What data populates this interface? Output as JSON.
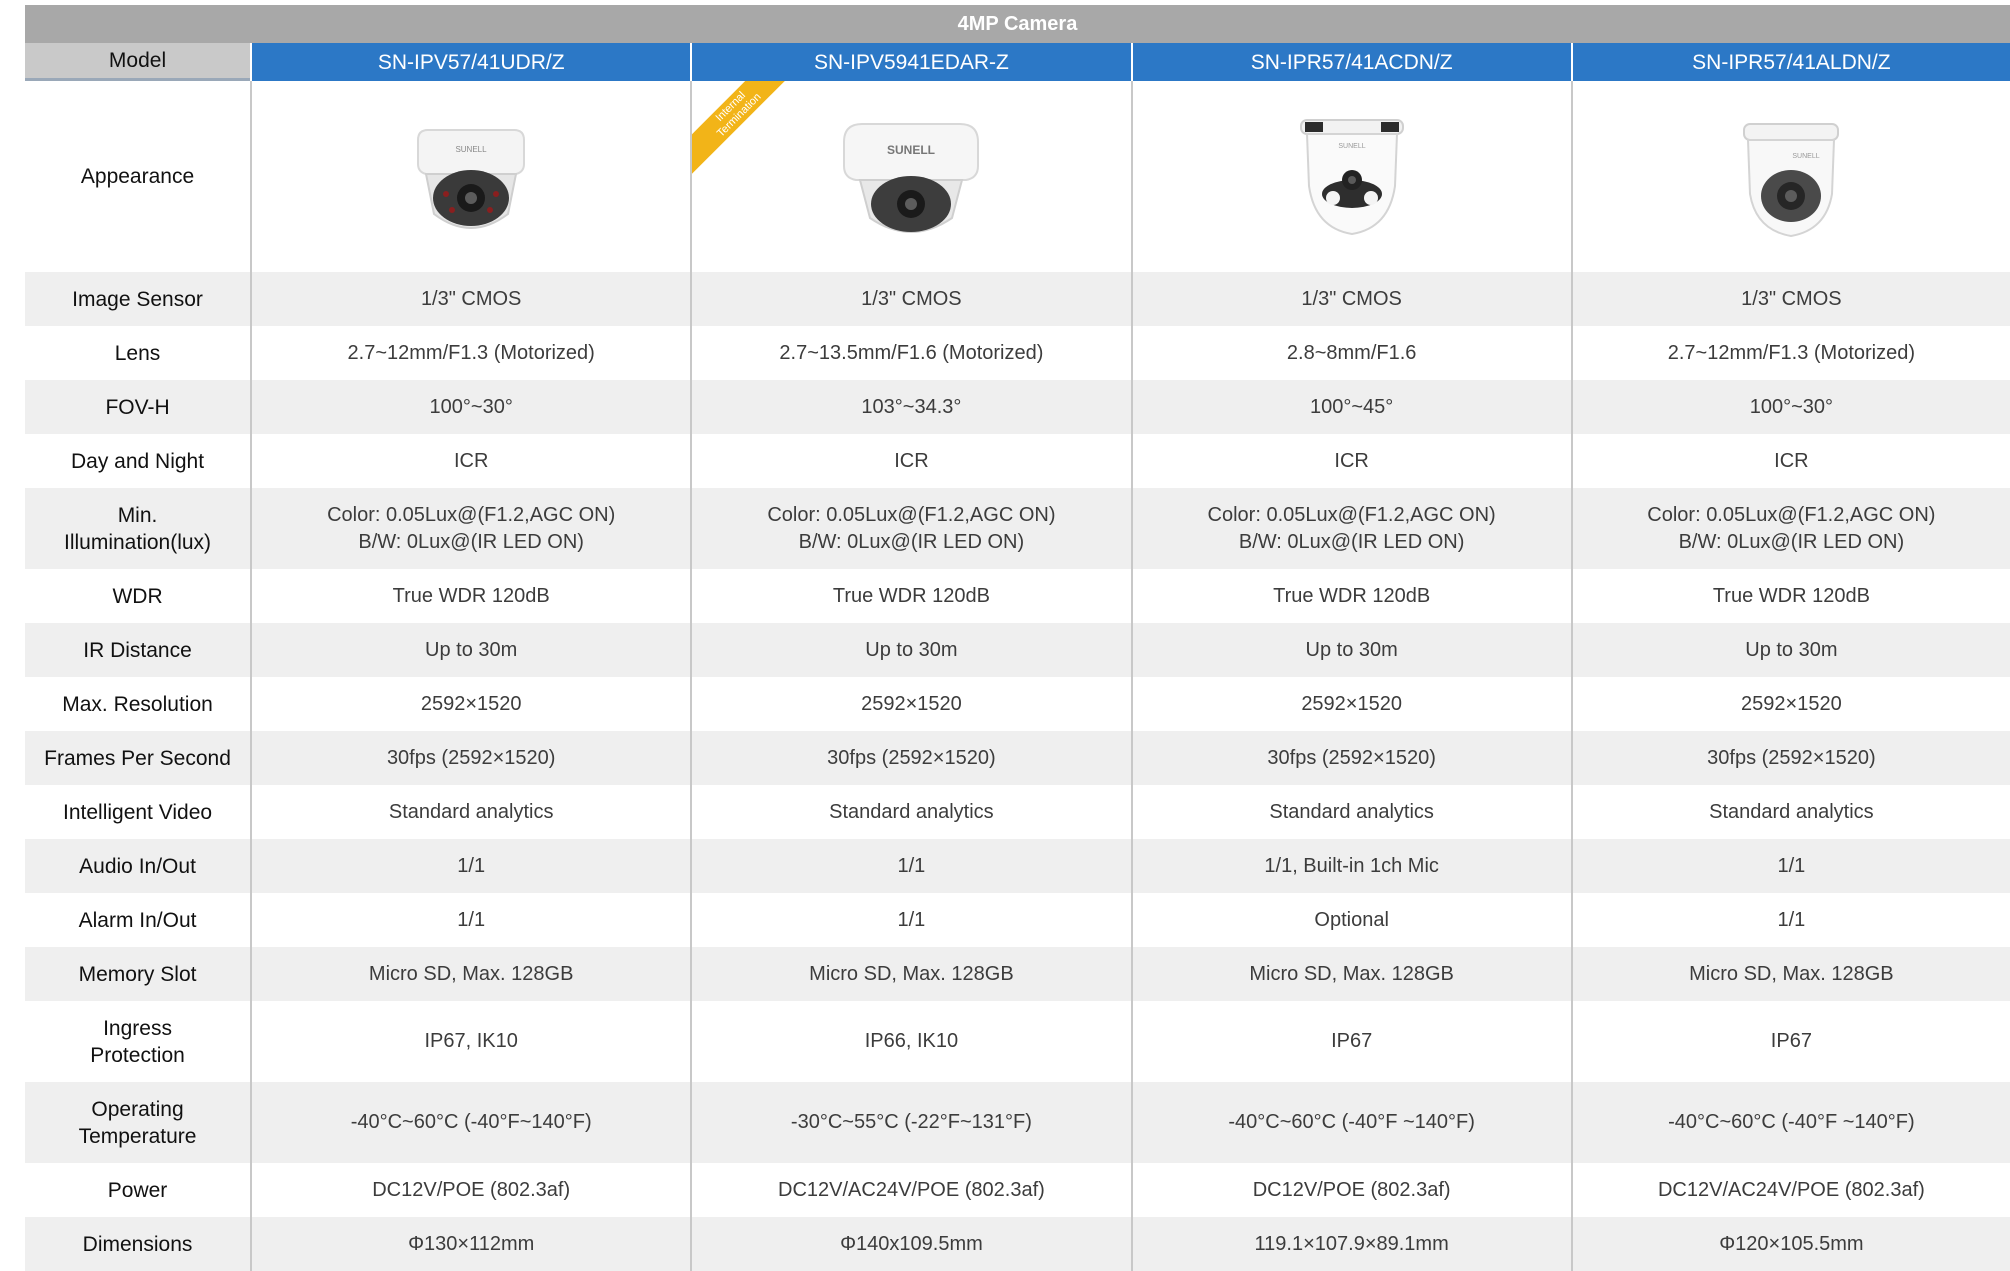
{
  "banner": "4MP Camera",
  "model_label": "Model",
  "models": [
    "SN-IPV57/41UDR/Z",
    "SN-IPV5941EDAR-Z",
    "SN-IPR57/41ACDN/Z",
    "SN-IPR57/41ALDN/Z"
  ],
  "appearance_label": "Appearance",
  "ribbon": [
    "Internal",
    "Termination"
  ],
  "camera_icons": [
    "dome-camera-icon",
    "dome-camera-icon",
    "turret-camera-icon",
    "turret-camera-icon"
  ],
  "brand": "SUNELL",
  "rows": [
    {
      "label": [
        "Image Sensor"
      ],
      "values": [
        [
          "1/3\" CMOS"
        ],
        [
          "1/3\" CMOS"
        ],
        [
          "1/3\" CMOS"
        ],
        [
          "1/3\" CMOS"
        ]
      ]
    },
    {
      "label": [
        "Lens"
      ],
      "values": [
        [
          "2.7~12mm/F1.3 (Motorized)"
        ],
        [
          "2.7~13.5mm/F1.6 (Motorized)"
        ],
        [
          "2.8~8mm/F1.6"
        ],
        [
          "2.7~12mm/F1.3 (Motorized)"
        ]
      ]
    },
    {
      "label": [
        "FOV-H"
      ],
      "values": [
        [
          "100°~30°"
        ],
        [
          "103°~34.3°"
        ],
        [
          "100°~45°"
        ],
        [
          "100°~30°"
        ]
      ]
    },
    {
      "label": [
        "Day and Night"
      ],
      "values": [
        [
          "ICR"
        ],
        [
          "ICR"
        ],
        [
          "ICR"
        ],
        [
          "ICR"
        ]
      ]
    },
    {
      "label": [
        "Min.",
        "Illumination(lux)"
      ],
      "values": [
        [
          "Color: 0.05Lux@(F1.2,AGC ON)",
          "B/W: 0Lux@(IR LED ON)"
        ],
        [
          "Color: 0.05Lux@(F1.2,AGC ON)",
          "B/W: 0Lux@(IR LED ON)"
        ],
        [
          "Color: 0.05Lux@(F1.2,AGC ON)",
          "B/W: 0Lux@(IR LED ON)"
        ],
        [
          "Color: 0.05Lux@(F1.2,AGC ON)",
          "B/W: 0Lux@(IR LED ON)"
        ]
      ]
    },
    {
      "label": [
        "WDR"
      ],
      "values": [
        [
          "True WDR 120dB"
        ],
        [
          "True WDR 120dB"
        ],
        [
          "True WDR 120dB"
        ],
        [
          "True WDR 120dB"
        ]
      ]
    },
    {
      "label": [
        "IR Distance"
      ],
      "values": [
        [
          "Up to 30m"
        ],
        [
          "Up to 30m"
        ],
        [
          "Up to 30m"
        ],
        [
          "Up to 30m"
        ]
      ]
    },
    {
      "label": [
        "Max. Resolution"
      ],
      "values": [
        [
          "2592×1520"
        ],
        [
          "2592×1520"
        ],
        [
          "2592×1520"
        ],
        [
          "2592×1520"
        ]
      ]
    },
    {
      "label": [
        "Frames Per Second"
      ],
      "values": [
        [
          "30fps (2592×1520)"
        ],
        [
          "30fps (2592×1520)"
        ],
        [
          "30fps (2592×1520)"
        ],
        [
          "30fps (2592×1520)"
        ]
      ]
    },
    {
      "label": [
        "Intelligent Video"
      ],
      "values": [
        [
          "Standard analytics"
        ],
        [
          "Standard analytics"
        ],
        [
          "Standard analytics"
        ],
        [
          "Standard analytics"
        ]
      ]
    },
    {
      "label": [
        "Audio In/Out"
      ],
      "values": [
        [
          "1/1"
        ],
        [
          "1/1"
        ],
        [
          "1/1, Built-in 1ch Mic"
        ],
        [
          "1/1"
        ]
      ]
    },
    {
      "label": [
        "Alarm In/Out"
      ],
      "values": [
        [
          "1/1"
        ],
        [
          "1/1"
        ],
        [
          "Optional"
        ],
        [
          "1/1"
        ]
      ]
    },
    {
      "label": [
        "Memory Slot"
      ],
      "values": [
        [
          "Micro SD, Max. 128GB"
        ],
        [
          "Micro SD, Max. 128GB"
        ],
        [
          "Micro SD, Max. 128GB"
        ],
        [
          "Micro SD, Max. 128GB"
        ]
      ]
    },
    {
      "label": [
        "Ingress",
        "Protection"
      ],
      "values": [
        [
          "IP67, IK10"
        ],
        [
          "IP66, IK10"
        ],
        [
          "IP67"
        ],
        [
          "IP67"
        ]
      ]
    },
    {
      "label": [
        "Operating",
        "Temperature"
      ],
      "values": [
        [
          "-40°C~60°C (-40°F~140°F)"
        ],
        [
          "-30°C~55°C (-22°F~131°F)"
        ],
        [
          "-40°C~60°C (-40°F ~140°F)"
        ],
        [
          "-40°C~60°C (-40°F ~140°F)"
        ]
      ]
    },
    {
      "label": [
        "Power"
      ],
      "values": [
        [
          "DC12V/POE (802.3af)"
        ],
        [
          "DC12V/AC24V/POE (802.3af)"
        ],
        [
          "DC12V/POE (802.3af)"
        ],
        [
          "DC12V/AC24V/POE (802.3af)"
        ]
      ]
    },
    {
      "label": [
        "Dimensions"
      ],
      "values": [
        [
          "Φ130×112mm"
        ],
        [
          "Φ140x109.5mm"
        ],
        [
          "119.1×107.9×89.1mm"
        ],
        [
          "Φ120×105.5mm"
        ]
      ]
    }
  ]
}
